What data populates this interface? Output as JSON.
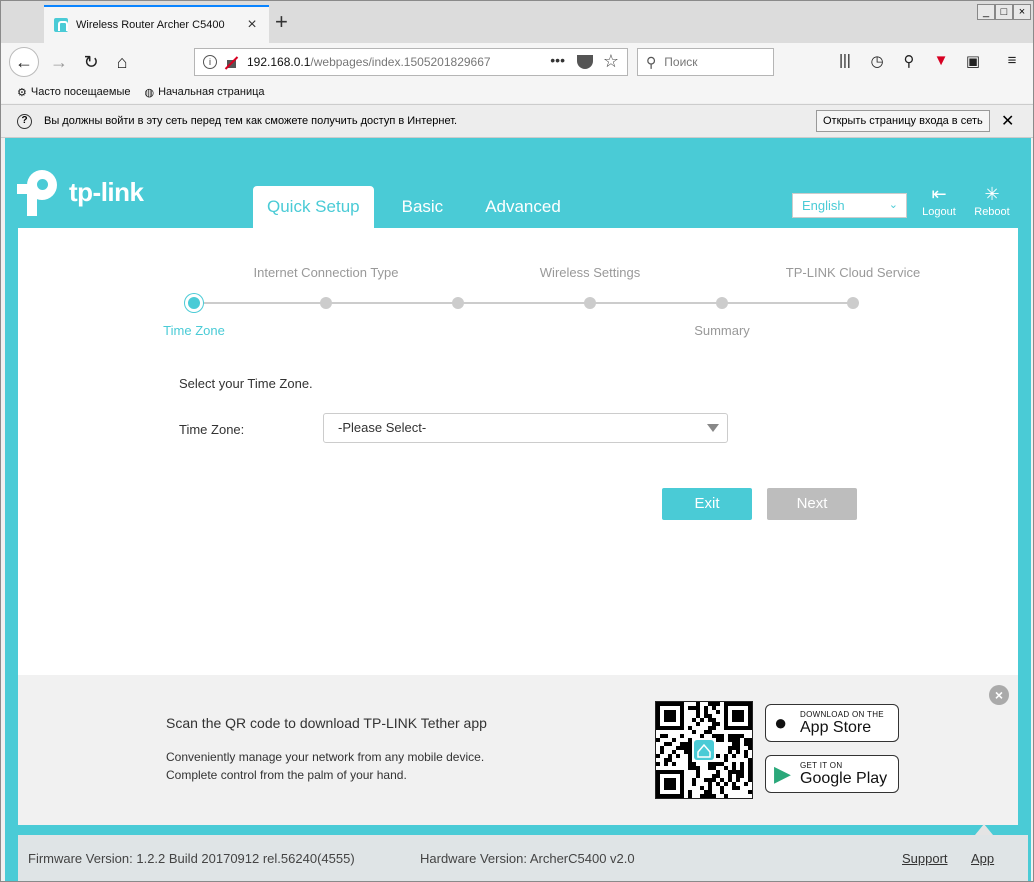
{
  "browser": {
    "tab_title": "Wireless Router Archer C5400",
    "tab_close": "×",
    "new_tab": "+",
    "window_buttons": [
      "_",
      "□",
      "×"
    ],
    "url_host": "192.168.0.1",
    "url_path": "/webpages/index.1505201829667",
    "url_more": "•••",
    "search_placeholder": "Поиск",
    "bookmarks": [
      "Часто посещаемые",
      "Начальная страница"
    ],
    "notification_text": "Вы должны войти в эту сеть перед тем как сможете получить доступ в Интернет.",
    "notification_button": "Открыть страницу входа в сеть"
  },
  "header": {
    "logo_text": "tp-link",
    "tabs": [
      "Quick Setup",
      "Basic",
      "Advanced"
    ],
    "active_tab": 0,
    "language": "English",
    "logout_label": "Logout",
    "reboot_label": "Reboot"
  },
  "wizard": {
    "steps_top": [
      "Internet Connection Type",
      "Wireless Settings",
      "TP-LINK Cloud Service"
    ],
    "steps_bottom": [
      "Time Zone",
      "Summary"
    ],
    "prompt": "Select your Time Zone.",
    "field_label": "Time Zone:",
    "select_value": "-Please Select-",
    "exit_label": "Exit",
    "next_label": "Next"
  },
  "promo": {
    "title": "Scan the QR code to download TP-LINK Tether app",
    "desc1": "Conveniently manage your network from any mobile device.",
    "desc2": "Complete control from the palm of your hand.",
    "appstore_small": "Download on the",
    "appstore_large": "App Store",
    "google_small": "GET IT ON",
    "google_large": "Google Play"
  },
  "footer": {
    "firmware": "Firmware Version: 1.2.2 Build 20170912 rel.56240(4555)",
    "hardware": "Hardware Version: ArcherC5400 v2.0",
    "support": "Support",
    "app": "App"
  },
  "colors": {
    "accent": "#4acbd6",
    "disabled": "#bdbdbd"
  }
}
